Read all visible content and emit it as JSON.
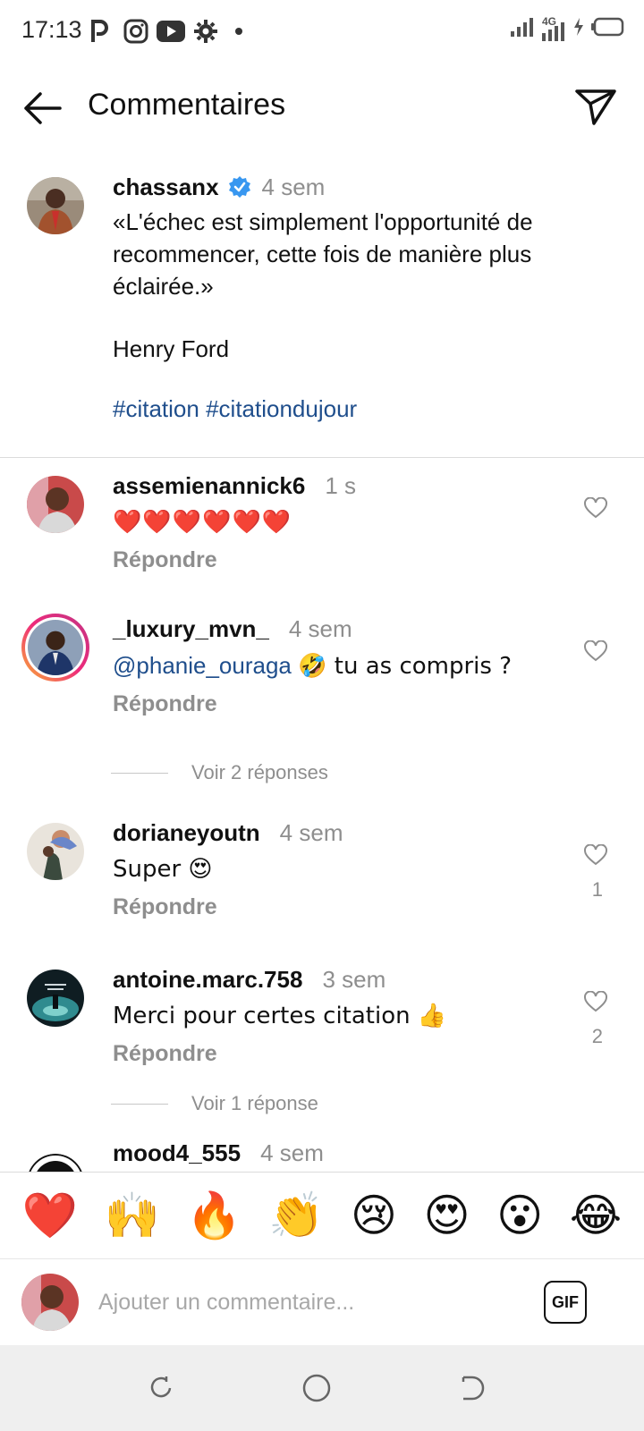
{
  "status_bar": {
    "time": "17:13",
    "icons": [
      "parking-icon",
      "instagram-icon",
      "youtube-icon",
      "gear-icon",
      "dot-icon"
    ],
    "network": "4G",
    "network_sub": "ll"
  },
  "header": {
    "title": "Commentaires",
    "back_icon": "arrow-left-icon",
    "share_icon": "paper-plane-icon"
  },
  "caption": {
    "username": "chassanx",
    "verified": true,
    "time": "4 sem",
    "lines": [
      "«L'échec est simplement l'opportunité de",
      "recommencer, cette fois de manière plus",
      "éclairée.»",
      "",
      "Henry Ford",
      ""
    ],
    "hashtags": [
      "#citation",
      "#citationdujour"
    ]
  },
  "comments": [
    {
      "username": "assemienannick6",
      "time": "1 s",
      "text": "❤️❤️❤️❤️❤️❤️",
      "reply_label": "Répondre",
      "likes": ""
    },
    {
      "username": "_luxury_mvn_",
      "time": "4 sem",
      "mention": "@phanie_ouraga",
      "text": "🤣 tu as compris ?",
      "reply_label": "Répondre",
      "likes": "",
      "has_story": true,
      "view_replies": "Voir 2 réponses"
    },
    {
      "username": "dorianeyoutn",
      "time": "4 sem",
      "text": "Super 😍",
      "reply_label": "Répondre",
      "likes": "1"
    },
    {
      "username": "antoine.marc.758",
      "time": "3 sem",
      "text": "Merci pour certes citation 👍",
      "reply_label": "Répondre",
      "likes": "2",
      "view_replies": "Voir 1 réponse"
    },
    {
      "username": "mood4_555",
      "time": "4 sem"
    }
  ],
  "emoji_bar": [
    "❤️",
    "🙌",
    "🔥",
    "👏",
    "😢",
    "😍",
    "😮",
    "😂"
  ],
  "composer": {
    "placeholder": "Ajouter un commentaire...",
    "gif_label": "GIF"
  },
  "nav": {
    "buttons": [
      "recents-icon",
      "home-icon",
      "back-icon"
    ]
  },
  "colors": {
    "link": "#1f4e8c",
    "muted": "#8e8e8e",
    "verified": "#3897f0",
    "divider": "#dbdbdb"
  }
}
